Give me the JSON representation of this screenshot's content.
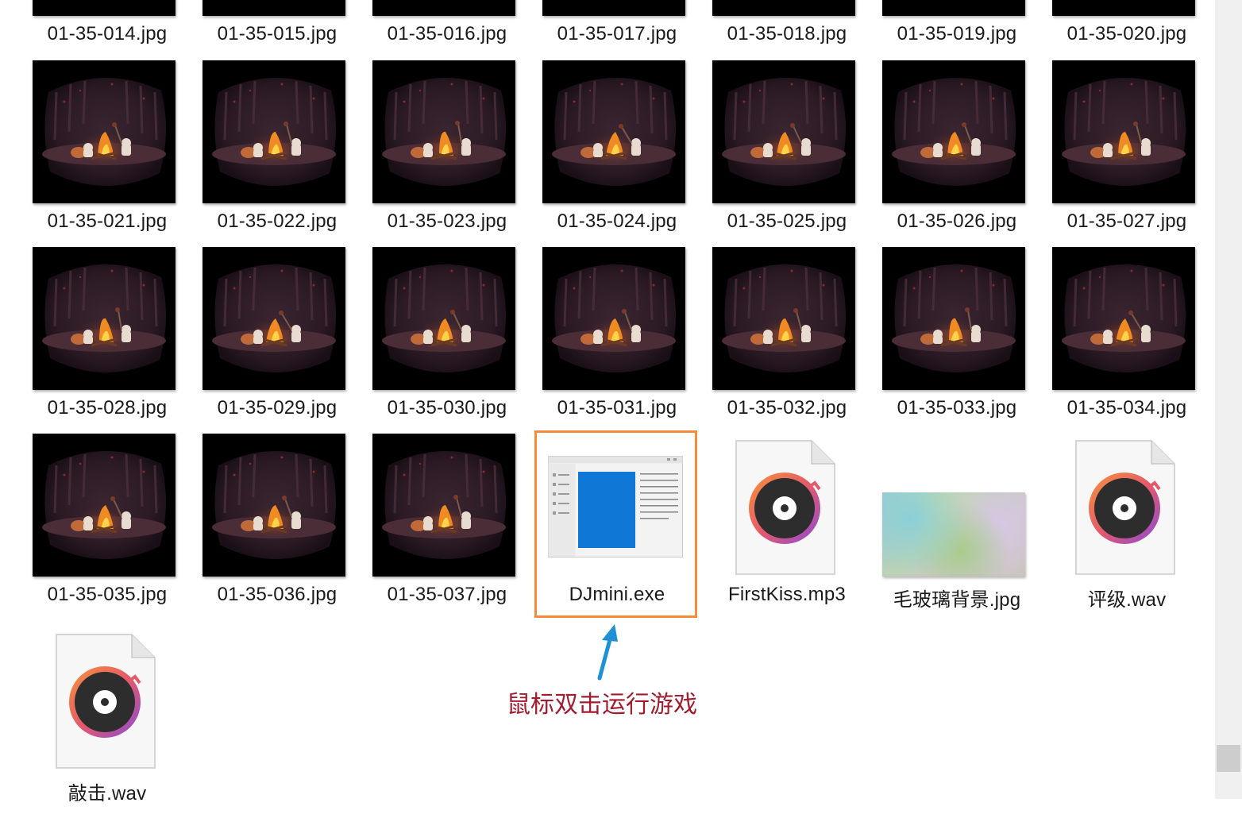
{
  "files": [
    {
      "name": "01-35-014.jpg",
      "kind": "image"
    },
    {
      "name": "01-35-015.jpg",
      "kind": "image"
    },
    {
      "name": "01-35-016.jpg",
      "kind": "image"
    },
    {
      "name": "01-35-017.jpg",
      "kind": "image"
    },
    {
      "name": "01-35-018.jpg",
      "kind": "image"
    },
    {
      "name": "01-35-019.jpg",
      "kind": "image"
    },
    {
      "name": "01-35-020.jpg",
      "kind": "image"
    },
    {
      "name": "01-35-021.jpg",
      "kind": "image"
    },
    {
      "name": "01-35-022.jpg",
      "kind": "image"
    },
    {
      "name": "01-35-023.jpg",
      "kind": "image"
    },
    {
      "name": "01-35-024.jpg",
      "kind": "image"
    },
    {
      "name": "01-35-025.jpg",
      "kind": "image"
    },
    {
      "name": "01-35-026.jpg",
      "kind": "image"
    },
    {
      "name": "01-35-027.jpg",
      "kind": "image"
    },
    {
      "name": "01-35-028.jpg",
      "kind": "image"
    },
    {
      "name": "01-35-029.jpg",
      "kind": "image"
    },
    {
      "name": "01-35-030.jpg",
      "kind": "image"
    },
    {
      "name": "01-35-031.jpg",
      "kind": "image"
    },
    {
      "name": "01-35-032.jpg",
      "kind": "image"
    },
    {
      "name": "01-35-033.jpg",
      "kind": "image"
    },
    {
      "name": "01-35-034.jpg",
      "kind": "image"
    },
    {
      "name": "01-35-035.jpg",
      "kind": "image"
    },
    {
      "name": "01-35-036.jpg",
      "kind": "image"
    },
    {
      "name": "01-35-037.jpg",
      "kind": "image"
    },
    {
      "name": "DJmini.exe",
      "kind": "exe",
      "selected": true
    },
    {
      "name": "FirstKiss.mp3",
      "kind": "audio"
    },
    {
      "name": "毛玻璃背景.jpg",
      "kind": "blur-image"
    },
    {
      "name": "评级.wav",
      "kind": "audio"
    },
    {
      "name": "敲击.wav",
      "kind": "audio"
    }
  ],
  "annotation": {
    "text": "鼠标双击运行游戏"
  },
  "colors": {
    "selection_border": "#f7893b",
    "annotation_text": "#a11c2e",
    "arrow": "#1f8fd6",
    "thumb_bg": "#000000"
  },
  "icons": {
    "image": "campfire-thumbnail-icon",
    "exe": "application-window-icon",
    "audio": "music-disc-icon",
    "blur-image": "blurred-background-thumbnail"
  }
}
